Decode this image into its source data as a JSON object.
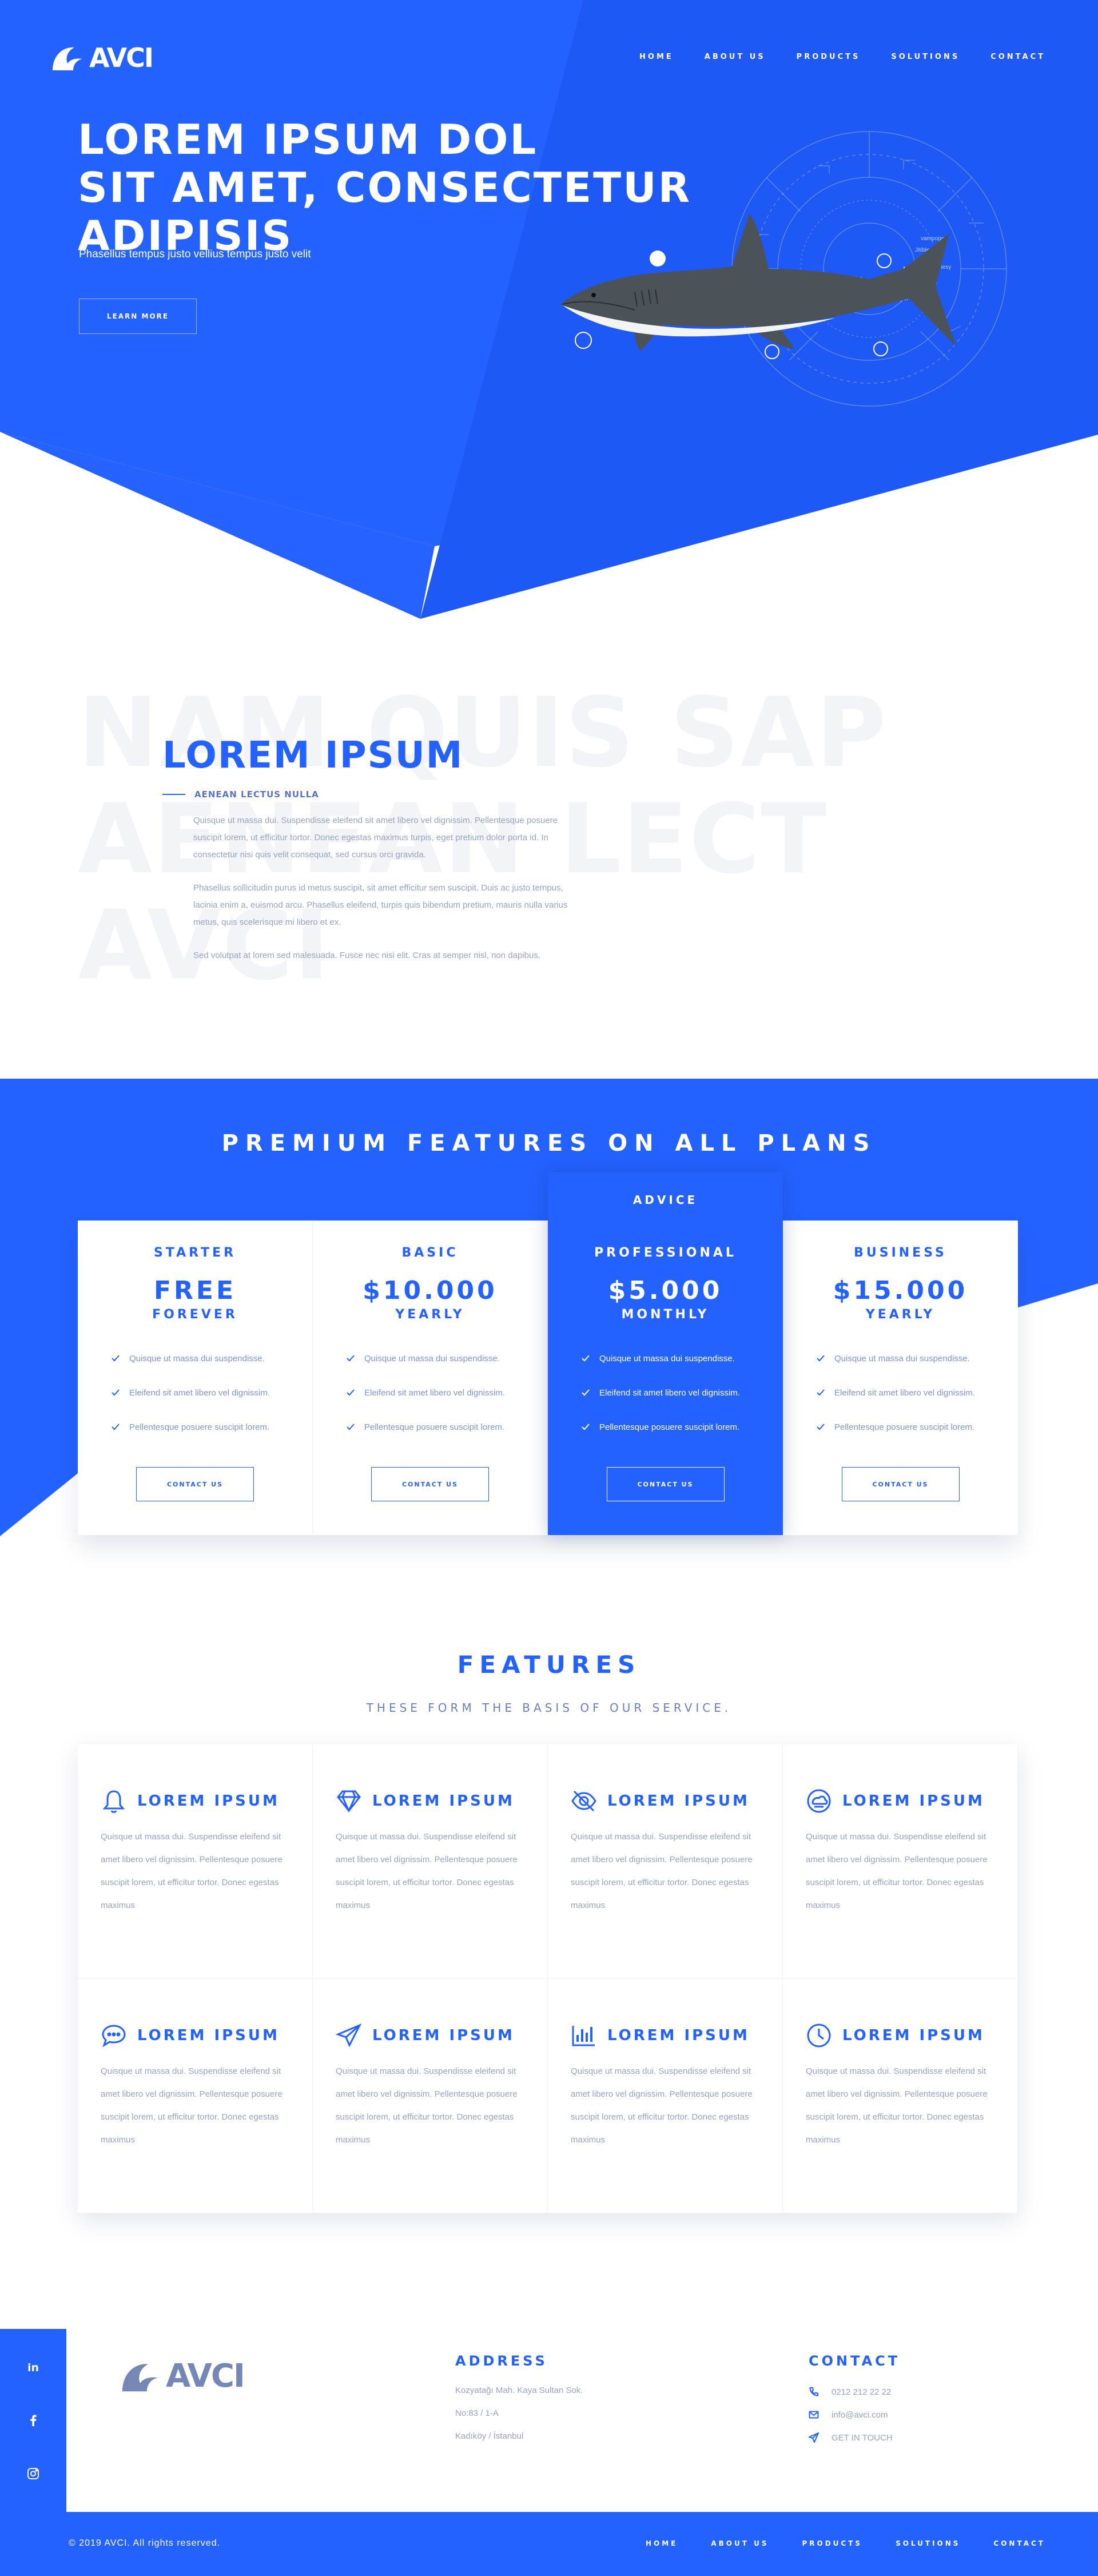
{
  "colors": {
    "primary": "#2462ff",
    "dark_blue": "#1a4fe0",
    "text_muted": "#97a3c4"
  },
  "brand": {
    "name": "AVCI",
    "logo_icon": "crescent-bird-icon"
  },
  "nav": {
    "items": [
      "HOME",
      "ABOUT US",
      "PRODUCTS",
      "SOLUTIONS",
      "CONTACT"
    ]
  },
  "hero": {
    "title_line1": "LOREM IPSUM DOL",
    "title_line2": "SIT AMET, CONSECTETUR ADIPISIS",
    "subtitle": "Phasellus tempus justo vellius tempus justo velit",
    "cta": "LEARN MORE",
    "illustration": "shark-with-hud-overlay"
  },
  "about": {
    "ghost_line1": "NAM QUIS SAP",
    "ghost_line2": "AENEAN LECT",
    "ghost_line3": "AVCI",
    "title": "LOREM IPSUM",
    "subtitle": "AENEAN LECTUS NULLA",
    "paragraphs": [
      "Quisque ut massa dui. Suspendisse eleifend sit amet libero vel dignissim. Pellentesque posuere suscipit lorem, ut efficitur tortor. Donec egestas maximus turpis, eget pretium dolor porta id. In consectetur nisi quis velit consequat, sed cursus orci gravida.",
      "Phasellus sollicitudin purus id metus suscipit, sit amet efficitur sem suscipit. Duis ac justo tempus, lacinia enim a, euismod arcu. Phasellus eleifend, turpis quis bibendum pretium, mauris nulla varius metus, quis scelerisque mi libero et ex.",
      "Sed volutpat at lorem sed malesuada. Fusce nec nisi elit. Cras at semper nisl, non dapibus."
    ]
  },
  "pricing": {
    "title": "PREMIUM FEATURES ON ALL PLANS",
    "highlight_label": "ADVICE",
    "plans": [
      {
        "name": "STARTER",
        "price": "FREE",
        "period": "FOREVER",
        "features": [
          "Quisque ut massa dui suspendisse.",
          "Eleifend sit amet libero vel dignissim.",
          "Pellentesque posuere suscipit lorem."
        ],
        "cta": "CONTACT US"
      },
      {
        "name": "BASIC",
        "price": "$10.000",
        "period": "YEARLY",
        "features": [
          "Quisque ut massa dui suspendisse.",
          "Eleifend sit amet libero vel dignissim.",
          "Pellentesque posuere suscipit lorem."
        ],
        "cta": "CONTACT US"
      },
      {
        "name": "PROFESSIONAL",
        "price": "$5.000",
        "period": "MONTHLY",
        "features": [
          "Quisque ut massa dui suspendisse.",
          "Eleifend sit amet libero vel dignissim.",
          "Pellentesque posuere suscipit lorem."
        ],
        "cta": "CONTACT US"
      },
      {
        "name": "BUSINESS",
        "price": "$15.000",
        "period": "YEARLY",
        "features": [
          "Quisque ut massa dui suspendisse.",
          "Eleifend sit amet libero vel dignissim.",
          "Pellentesque posuere suscipit lorem."
        ],
        "cta": "CONTACT US"
      }
    ]
  },
  "features": {
    "title": "FEATURES",
    "subtitle": "THESE FORM THE BASIS OF OUR SERVICE.",
    "items": [
      {
        "icon": "bell-icon",
        "title": "LOREM IPSUM",
        "text": "Quisque ut massa dui. Suspendisse eleifend sit amet libero vel dignissim. Pellentesque posuere suscipit lorem, ut efficitur tortor. Donec egestas maximus"
      },
      {
        "icon": "diamond-icon",
        "title": "LOREM IPSUM",
        "text": "Quisque ut massa dui. Suspendisse eleifend sit amet libero vel dignissim. Pellentesque posuere suscipit lorem, ut efficitur tortor. Donec egestas maximus"
      },
      {
        "icon": "eye-slash-icon",
        "title": "LOREM IPSUM",
        "text": "Quisque ut massa dui. Suspendisse eleifend sit amet libero vel dignissim. Pellentesque posuere suscipit lorem, ut efficitur tortor. Donec egestas maximus"
      },
      {
        "icon": "cloud-tasks-icon",
        "title": "LOREM IPSUM",
        "text": "Quisque ut massa dui. Suspendisse eleifend sit amet libero vel dignissim. Pellentesque posuere suscipit lorem, ut efficitur tortor. Donec egestas maximus"
      },
      {
        "icon": "chat-bubble-icon",
        "title": "LOREM IPSUM",
        "text": "Quisque ut massa dui. Suspendisse eleifend sit amet libero vel dignissim. Pellentesque posuere suscipit lorem, ut efficitur tortor. Donec egestas maximus"
      },
      {
        "icon": "paper-plane-icon",
        "title": "LOREM IPSUM",
        "text": "Quisque ut massa dui. Suspendisse eleifend sit amet libero vel dignissim. Pellentesque posuere suscipit lorem, ut efficitur tortor. Donec egestas maximus"
      },
      {
        "icon": "bar-chart-icon",
        "title": "LOREM IPSUM",
        "text": "Quisque ut massa dui. Suspendisse eleifend sit amet libero vel dignissim. Pellentesque posuere suscipit lorem, ut efficitur tortor. Donec egestas maximus"
      },
      {
        "icon": "clock-icon",
        "title": "LOREM IPSUM",
        "text": "Quisque ut massa dui. Suspendisse eleifend sit amet libero vel dignissim. Pellentesque posuere suscipit lorem, ut efficitur tortor. Donec egestas maximus"
      }
    ]
  },
  "footer": {
    "social": [
      "linkedin-icon",
      "facebook-icon",
      "instagram-icon"
    ],
    "address_title": "ADDRESS",
    "address_lines": [
      "Kozyatağı Mah. Kaya Sultan Sok.",
      "No:83 / 1-A",
      "Kadıköy / İstanbul"
    ],
    "contact_title": "CONTACT",
    "contacts": [
      {
        "icon": "phone-icon",
        "text": "0212 212 22 22"
      },
      {
        "icon": "mail-icon",
        "text": "info@avci.com"
      },
      {
        "icon": "send-icon",
        "text": "GET IN TOUCH"
      }
    ],
    "copyright": "© 2019 AVCI. All rights reserved.",
    "nav": [
      "HOME",
      "ABOUT US",
      "PRODUCTS",
      "SOLUTIONS",
      "CONTACT"
    ]
  }
}
